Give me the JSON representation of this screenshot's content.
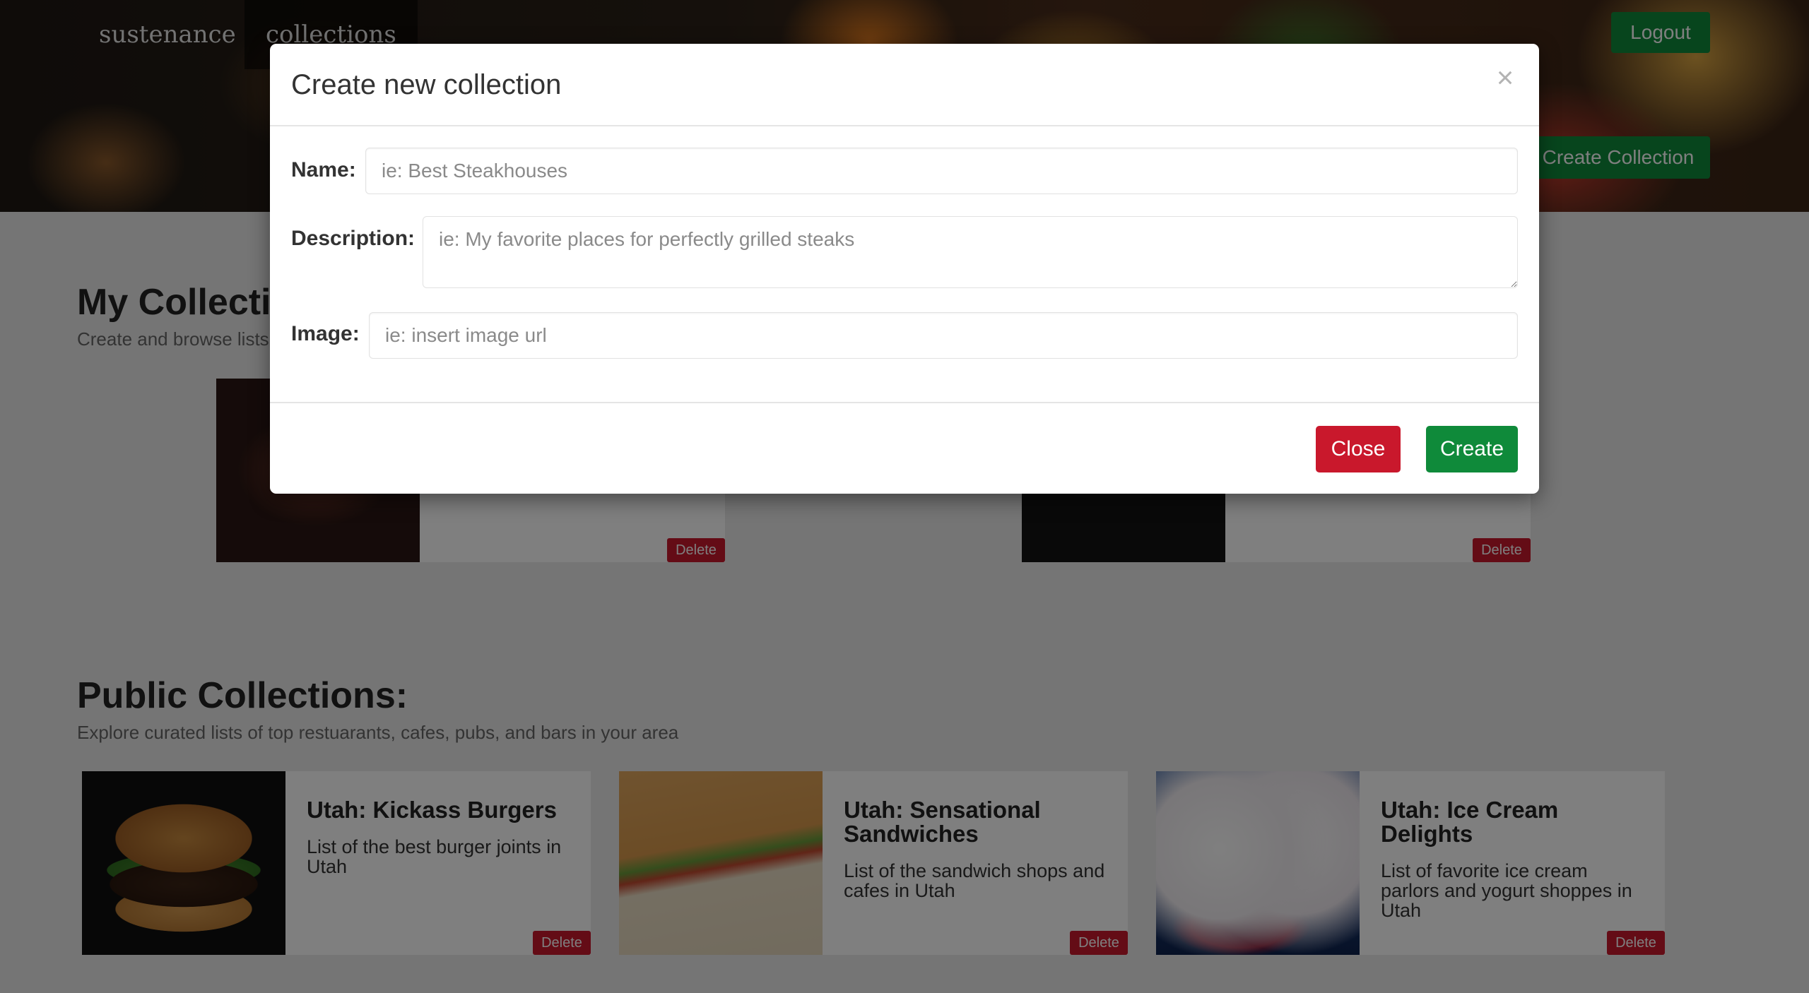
{
  "nav": {
    "brand": "sustenance",
    "collections": "collections",
    "logout": "Logout",
    "create_collection": "Create Collection"
  },
  "my_collections": {
    "title": "My Collections:",
    "subtitle": "Create and browse lists",
    "cards": [
      {
        "image_desc": "steak-image",
        "delete_label": "Delete"
      },
      {
        "image_desc": "dessert-plate-image",
        "delete_label": "Delete"
      }
    ]
  },
  "public_collections": {
    "title": "Public Collections:",
    "subtitle": "Explore curated lists of top restuarants, cafes, pubs, and bars in your area",
    "cards": [
      {
        "title": "Utah: Kickass Burgers",
        "description": "List of the best burger joints in Utah",
        "delete_label": "Delete"
      },
      {
        "title": "Utah: Sensational Sandwiches",
        "description": "List of the sandwich shops and cafes in Utah",
        "delete_label": "Delete"
      },
      {
        "title": "Utah: Ice Cream Delights",
        "description": "List of favorite ice cream parlors and yogurt shoppes in Utah",
        "delete_label": "Delete"
      }
    ]
  },
  "modal": {
    "title": "Create new collection",
    "close_icon": "×",
    "fields": {
      "name": {
        "label": "Name:",
        "placeholder": "ie: Best Steakhouses",
        "value": ""
      },
      "description": {
        "label": "Description:",
        "placeholder": "ie: My favorite places for perfectly grilled steaks",
        "value": ""
      },
      "image": {
        "label": "Image:",
        "placeholder": "ie: insert image url",
        "value": ""
      }
    },
    "close_button": "Close",
    "create_button": "Create"
  },
  "colors": {
    "green": "#0f8a3a",
    "red": "#c9182c"
  }
}
